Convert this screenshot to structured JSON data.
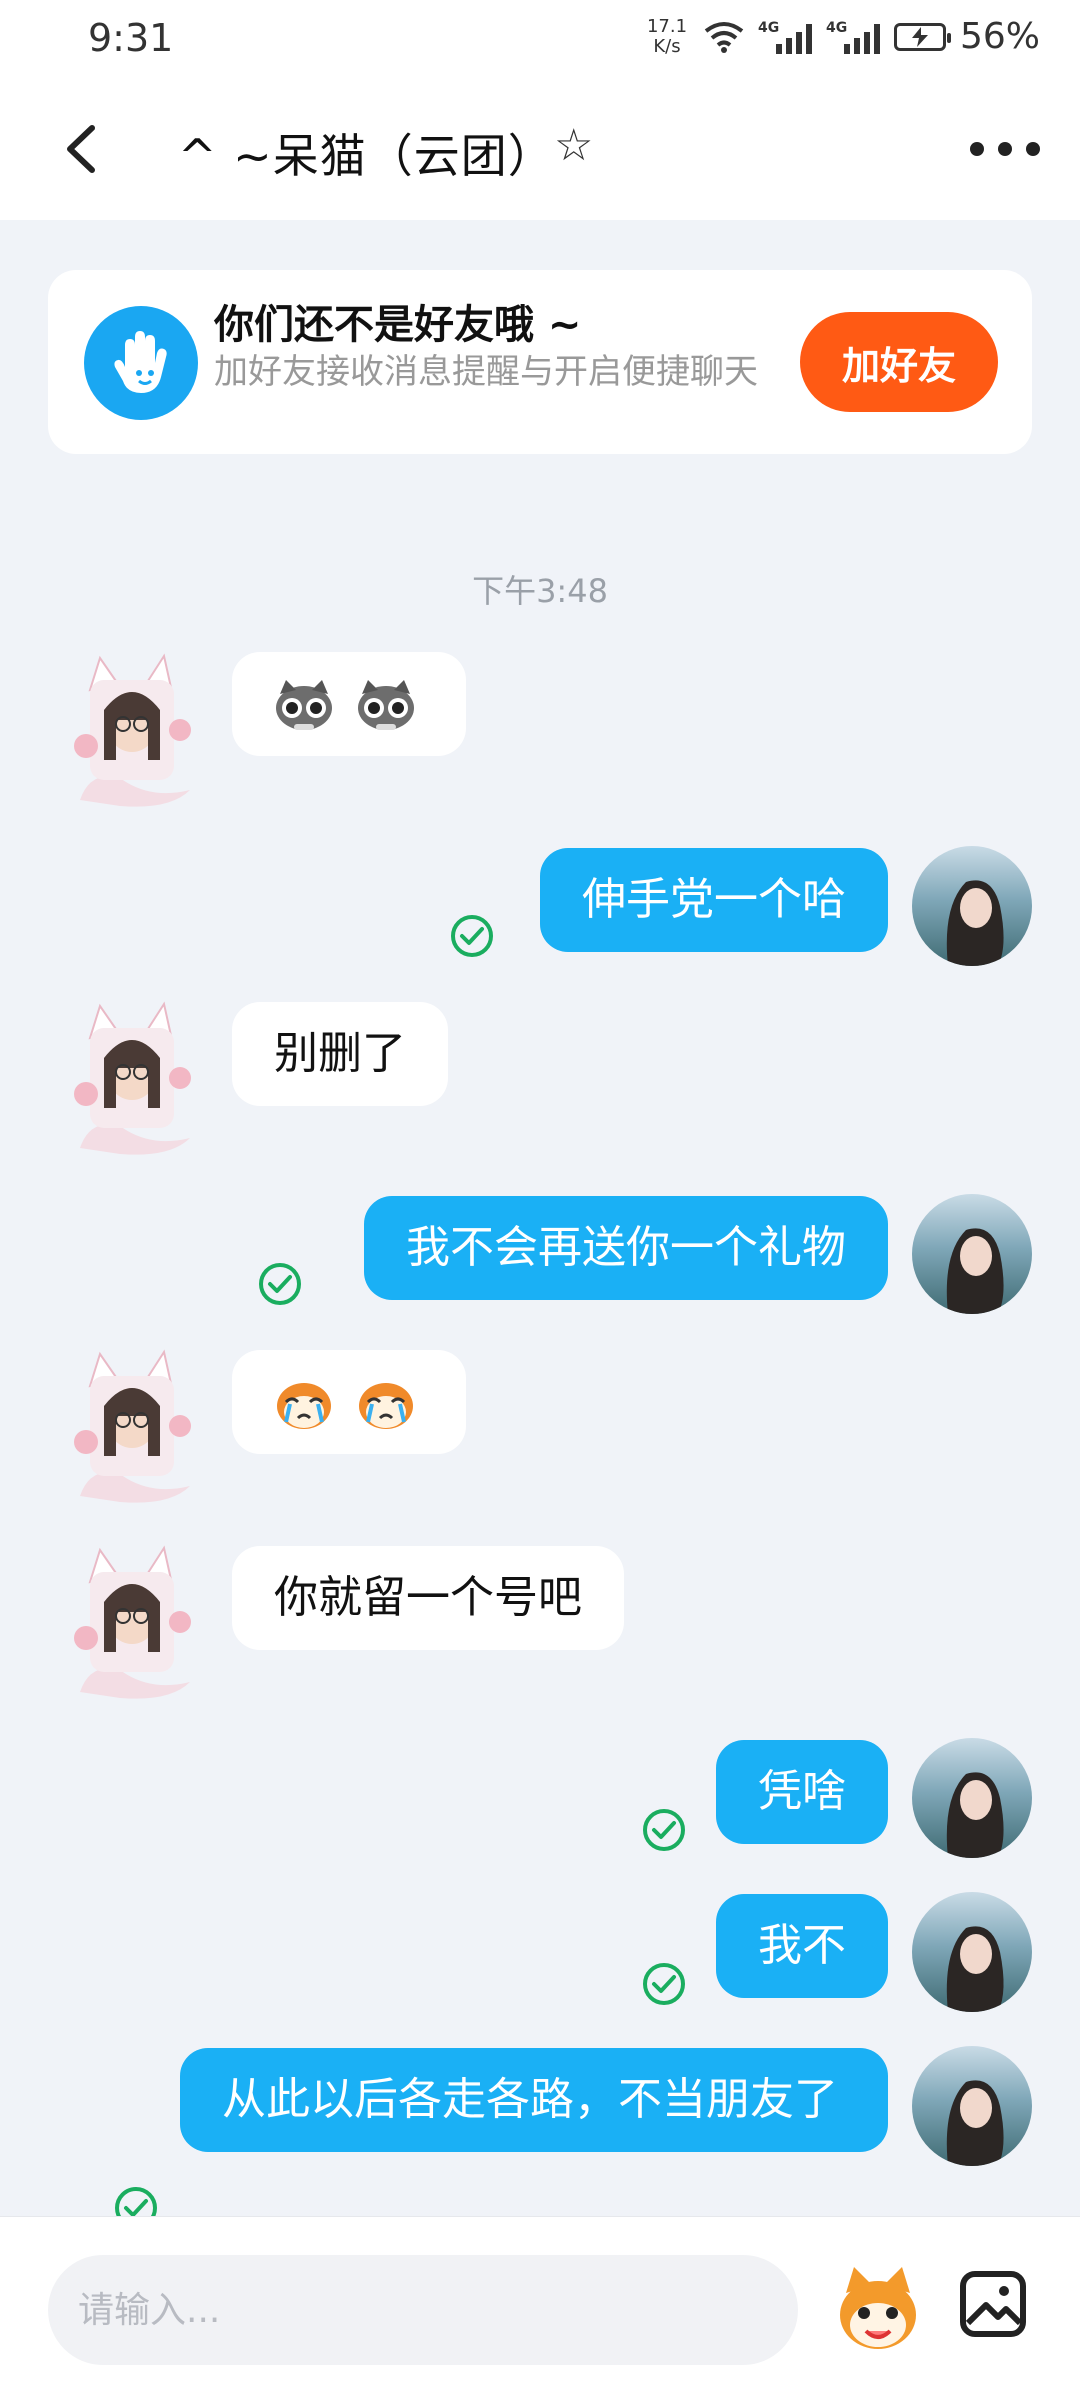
{
  "status_bar": {
    "time": "9:31",
    "net_speed_value": "17.1",
    "net_speed_unit": "K/s",
    "sim1": "4G",
    "sim2": "4G",
    "battery": "56%"
  },
  "header": {
    "title": "^ ~呆猫（云团）",
    "star": "☆"
  },
  "friend_card": {
    "title": "你们还不是好友哦 ~",
    "subtitle": "加好友接收消息提醒与开启便捷聊天",
    "add_button": "加好友"
  },
  "timestamp": "下午3:48",
  "messages": [
    {
      "side": "left",
      "type": "emoji",
      "emojis": [
        "raccoon-face-icon",
        "raccoon-face-icon"
      ]
    },
    {
      "side": "right",
      "text": "伸手党一个哈",
      "status": "read"
    },
    {
      "side": "left",
      "text": "别删了"
    },
    {
      "side": "right",
      "text": "我不会再送你一个礼物",
      "status": "read"
    },
    {
      "side": "left",
      "type": "emoji",
      "emojis": [
        "crying-face-icon",
        "crying-face-icon"
      ]
    },
    {
      "side": "left",
      "text": "你就留一个号吧"
    },
    {
      "side": "right",
      "text": "凭啥",
      "status": "read"
    },
    {
      "side": "right",
      "text": "我不",
      "status": "read"
    },
    {
      "side": "right",
      "text": "从此以后各走各路，不当朋友了",
      "status": "read"
    }
  ],
  "input": {
    "placeholder": "请输入..."
  },
  "colors": {
    "accent_blue": "#1ab0f5",
    "add_friend_orange": "#ff5a14",
    "read_check_green": "#1aad5f",
    "background": "#f0f3f8"
  }
}
